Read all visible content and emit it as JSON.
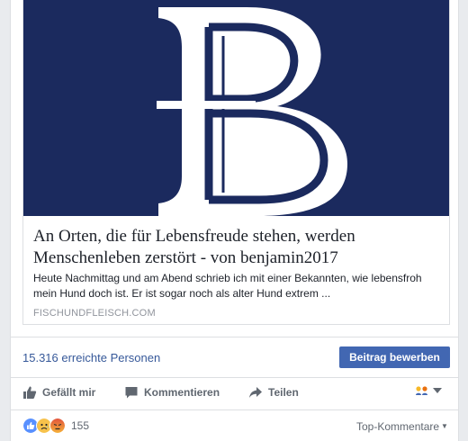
{
  "link_preview": {
    "title": "An Orten, die für Lebensfreude stehen, werden Menschenleben zerstört - von benjamin2017",
    "description": "Heute Nachmittag und am Abend schrieb ich mit einer Bekannten, wie lebensfroh mein Hund doch ist. Er ist sogar noch als alter Hund extrem ...",
    "domain": "FISCHUNDFLEISCH.COM",
    "hero_color": "#1b2a5e"
  },
  "insights": {
    "reach_text": "15.316 erreichte Personen",
    "boost_label": "Beitrag bewerben"
  },
  "actions": {
    "like_label": "Gefällt mir",
    "comment_label": "Kommentieren",
    "share_label": "Teilen"
  },
  "reactions": {
    "count": "155",
    "icons": [
      "like-reaction-icon",
      "sad-reaction-icon",
      "angry-reaction-icon"
    ]
  },
  "comments": {
    "sort_label": "Top-Kommentare"
  },
  "colors": {
    "link": "#365899",
    "button": "#4267b2",
    "secondary_text": "#606770",
    "muted": "#90949c"
  }
}
